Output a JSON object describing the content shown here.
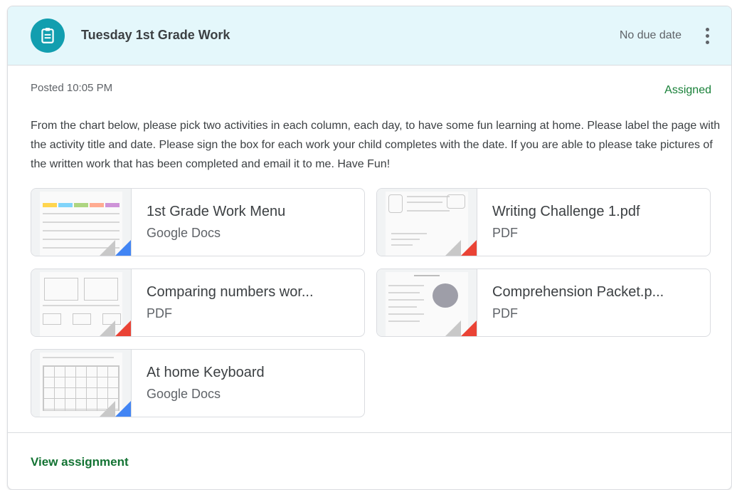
{
  "assignment": {
    "title": "Tuesday 1st Grade Work",
    "due": "No due date",
    "posted": "Posted 10:05 PM",
    "status": "Assigned",
    "description": "From the chart below, please pick two activities in each column, each day, to have some fun learning at home. Please label the page with the activity title and date. Please sign the box for each work your child completes with the date. If you are able to please take pictures of the written work that has been completed and email it to me. Have Fun!",
    "view_label": "View assignment",
    "icon": "assignment-icon"
  },
  "attachments": [
    {
      "name": "1st Grade Work Menu",
      "type": "Google Docs",
      "corner_color": "#4285f4"
    },
    {
      "name": "Writing Challenge 1.pdf",
      "type": "PDF",
      "corner_color": "#ea4335"
    },
    {
      "name": "Comparing numbers wor...",
      "type": "PDF",
      "corner_color": "#ea4335"
    },
    {
      "name": "Comprehension Packet.p...",
      "type": "PDF",
      "corner_color": "#ea4335"
    },
    {
      "name": "At home Keyboard",
      "type": "Google Docs",
      "corner_color": "#4285f4"
    }
  ],
  "colors": {
    "accent": "#129eaf",
    "status": "#188038"
  }
}
